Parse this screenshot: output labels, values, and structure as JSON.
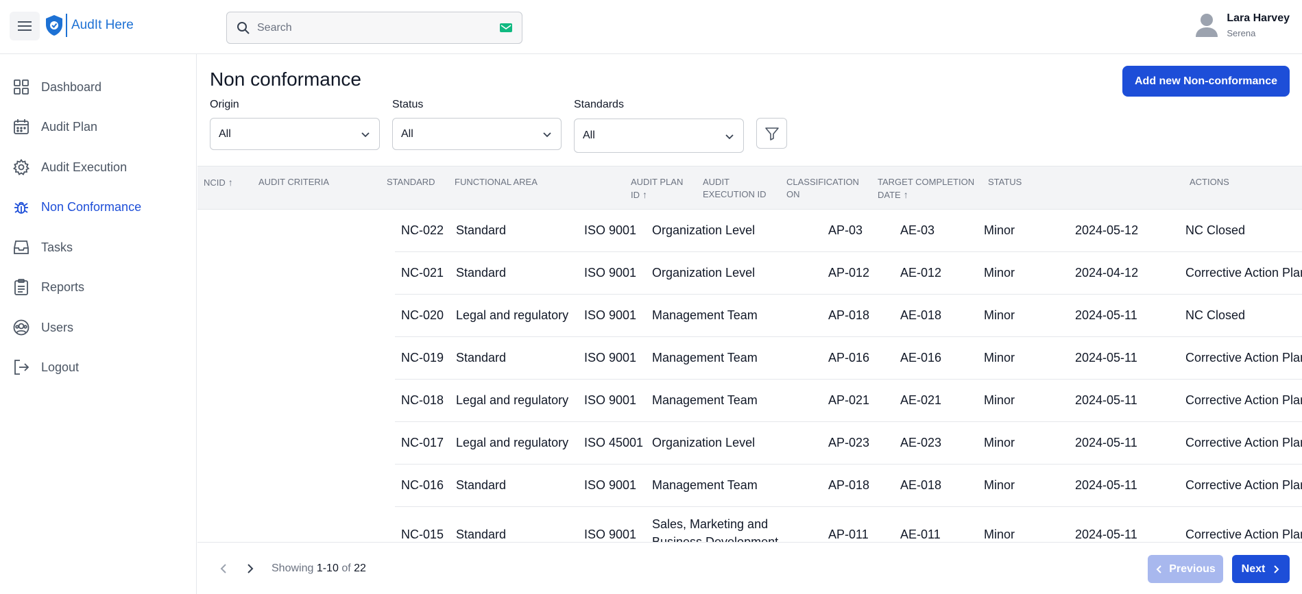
{
  "app": {
    "logo_text": "AudIt Here"
  },
  "search": {
    "placeholder": "Search"
  },
  "user": {
    "name": "Lara Harvey",
    "subtitle": "Serena"
  },
  "sidebar": {
    "items": [
      {
        "label": "Dashboard",
        "icon": "grid-icon",
        "active": false
      },
      {
        "label": "Audit Plan",
        "icon": "calendar-icon",
        "active": false
      },
      {
        "label": "Audit Execution",
        "icon": "gear-icon",
        "active": false
      },
      {
        "label": "Non Conformance",
        "icon": "bug-icon",
        "active": true
      },
      {
        "label": "Tasks",
        "icon": "inbox-icon",
        "active": false
      },
      {
        "label": "Reports",
        "icon": "clipboard-icon",
        "active": false
      },
      {
        "label": "Users",
        "icon": "user-circle-icon",
        "active": false
      },
      {
        "label": "Logout",
        "icon": "logout-icon",
        "active": false
      }
    ]
  },
  "main": {
    "title": "Non conformance",
    "add_button": "Add new Non-conformance",
    "filters": {
      "origin": {
        "label": "Origin",
        "value": "All"
      },
      "status": {
        "label": "Status",
        "value": "All"
      },
      "standards": {
        "label": "Standards",
        "value": "All"
      }
    }
  },
  "table": {
    "columns": [
      {
        "label": "NCID",
        "sort": "↑"
      },
      {
        "label": "AUDIT CRITERIA"
      },
      {
        "label": "STANDARD"
      },
      {
        "label": "FUNCTIONAL AREA"
      },
      {
        "label": "AUDIT PLAN ID",
        "sort": "↑"
      },
      {
        "label": "AUDIT EXECUTION ID"
      },
      {
        "label": "CLASSIFICATION ON"
      },
      {
        "label": "TARGET COMPLETION DATE",
        "sort": "↑"
      },
      {
        "label": "STATUS"
      },
      {
        "label": "ACTIONS"
      }
    ],
    "rows": [
      {
        "ncid": "NC-022",
        "criteria": "Standard",
        "standard": "ISO 9001",
        "area": "Organization Level",
        "plan": "AP-03",
        "exec": "AE-03",
        "class": "Minor",
        "date": "2024-05-12",
        "status": "NC Closed"
      },
      {
        "ncid": "NC-021",
        "criteria": "Standard",
        "standard": "ISO 9001",
        "area": "Organization Level",
        "plan": "AP-012",
        "exec": "AE-012",
        "class": "Minor",
        "date": "2024-04-12",
        "status": "Corrective Action Plan - Pending"
      },
      {
        "ncid": "NC-020",
        "criteria": "Legal and regulatory",
        "standard": "ISO 9001",
        "area": "Management Team",
        "plan": "AP-018",
        "exec": "AE-018",
        "class": "Minor",
        "date": "2024-05-11",
        "status": "NC Closed"
      },
      {
        "ncid": "NC-019",
        "criteria": "Standard",
        "standard": "ISO 9001",
        "area": "Management Team",
        "plan": "AP-016",
        "exec": "AE-016",
        "class": "Minor",
        "date": "2024-05-11",
        "status": "Corrective Action Plan - Pending"
      },
      {
        "ncid": "NC-018",
        "criteria": "Legal and regulatory",
        "standard": "ISO 9001",
        "area": "Management Team",
        "plan": "AP-021",
        "exec": "AE-021",
        "class": "Minor",
        "date": "2024-05-11",
        "status": "Corrective Action Plan - Pending"
      },
      {
        "ncid": "NC-017",
        "criteria": "Legal and regulatory",
        "standard": "ISO 45001",
        "area": "Organization Level",
        "plan": "AP-023",
        "exec": "AE-023",
        "class": "Minor",
        "date": "2024-05-11",
        "status": "Corrective Action Plan - Pending"
      },
      {
        "ncid": "NC-016",
        "criteria": "Standard",
        "standard": "ISO 9001",
        "area": "Management Team",
        "plan": "AP-018",
        "exec": "AE-018",
        "class": "Minor",
        "date": "2024-05-11",
        "status": "Corrective Action Plan - In Review"
      },
      {
        "ncid": "NC-015",
        "criteria": "Standard",
        "standard": "ISO 9001",
        "area": "Sales, Marketing and Business Development",
        "plan": "AP-011",
        "exec": "AE-011",
        "class": "Minor",
        "date": "2024-05-11",
        "status": "Corrective Action Plan - Pending"
      }
    ]
  },
  "pagination": {
    "showing_prefix": "Showing",
    "range": "1-10",
    "of_text": "of",
    "total": "22",
    "previous_label": "Previous",
    "next_label": "Next"
  },
  "colors": {
    "primary": "#1d4ed8",
    "danger": "#dc2626",
    "logo": "#1d71d4"
  }
}
